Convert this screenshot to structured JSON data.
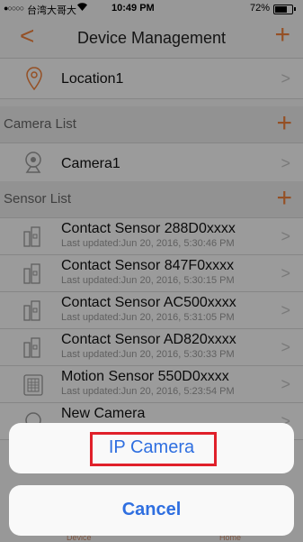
{
  "status_bar": {
    "signal": "●○○○○",
    "carrier": "台湾大哥大",
    "wifi": "Wi-Fi",
    "time": "10:49 PM",
    "battery": "72%"
  },
  "nav": {
    "back_icon": "chevron-left",
    "title": "Device Management",
    "add_icon": "plus"
  },
  "location_row": {
    "label": "Location1"
  },
  "camera_section": {
    "label": "Camera List"
  },
  "camera_row": {
    "label": "Camera1"
  },
  "sensor_section": {
    "label": "Sensor List"
  },
  "sensors": [
    {
      "title": "Contact Sensor 288D0xxxx",
      "updated": "Last updated:Jun 20, 2016, 5:30:46 PM",
      "icon": "contact-sensor"
    },
    {
      "title": "Contact Sensor 847F0xxxx",
      "updated": "Last updated:Jun 20, 2016, 5:30:15 PM",
      "icon": "contact-sensor"
    },
    {
      "title": "Contact Sensor AC500xxxx",
      "updated": "Last updated:Jun 20, 2016, 5:31:05 PM",
      "icon": "contact-sensor"
    },
    {
      "title": "Contact Sensor AD820xxxx",
      "updated": "Last updated:Jun 20, 2016, 5:30:33 PM",
      "icon": "contact-sensor"
    },
    {
      "title": "Motion Sensor 550D0xxxx",
      "updated": "Last updated:Jun 20, 2016, 5:23:54 PM",
      "icon": "motion-sensor"
    }
  ],
  "partial_row": {
    "title": "New Camera"
  },
  "action_sheet": {
    "option": "IP Camera",
    "cancel": "Cancel"
  },
  "tab_bar": {
    "left": "Device",
    "right": "Home"
  },
  "colors": {
    "accent": "#f0823c",
    "action_blue": "#2f6fe0",
    "highlight": "#e0202a"
  }
}
